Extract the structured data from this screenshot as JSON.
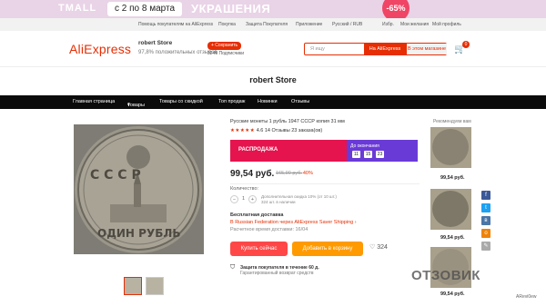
{
  "banner": {
    "brand": "TMALL",
    "dates": "с 2 по 8 марта",
    "promo": "УКРАШЕНИЯ",
    "discount": "-65%"
  },
  "topbar": {
    "items": [
      "Помощь покупателям на AliExpress",
      "Покупка",
      "Защита Покупателя",
      "Приложение",
      "Русский / RUB",
      "Избр.",
      "Мои желания",
      "Мой профиль"
    ]
  },
  "header": {
    "logo": "AliExpress",
    "store_name": "robert Store",
    "store_rating": "97,8% положительных отзывов",
    "save_button": "+ Сохранить",
    "subscribers": "3249 Подписчики",
    "search_placeholder": "Я ищу",
    "search_aliexpress": "На AliExpress",
    "search_store": "В этом магазине",
    "cart_count": "0"
  },
  "store_title": "robert Store",
  "nav": {
    "items": [
      "Главная страница",
      "Товары",
      "Товары со скидкой",
      "Топ продаж",
      "Новинки",
      "Отзывы"
    ]
  },
  "product": {
    "title": "Русские монеты 1 рубль 1947 СССР копия 31 мм",
    "stars": "★★★★★",
    "rating": "4.6",
    "reviews": "14 Отзывы",
    "orders": "23 заказа(ов)",
    "sale_label": "РАСПРОДАЖА",
    "countdown_label": "До окончания",
    "countdown": [
      "11",
      "15",
      "23"
    ],
    "price": "99,54 руб.",
    "old_price": "165,90 руб.",
    "discount": "-40%",
    "qty_label": "Количество:",
    "qty": "1",
    "qty_info_1": "Дополнительная скидка 10% (от 10 шт.)",
    "qty_info_2": "324 шт. в наличии",
    "shipping_title": "Бесплатная доставка",
    "shipping_line": "В Russian Federation через AliExpress Saver Shipping ›",
    "shipping_date": "Расчетное время доставки: 16/04",
    "buy_now": "Купить сейчас",
    "add_to_cart": "Добавить в корзину",
    "wish_count": "324",
    "protection_title": "Защита покупателя в течение 60 д.",
    "protection_sub": "Гарантированный возврат средств"
  },
  "recommend": {
    "title": "Рекомендуем вам",
    "prices": [
      "99,54 руб.",
      "99,54 руб.",
      "99,54 руб."
    ]
  },
  "coin": {
    "text_top": "С С С Р",
    "text_bottom": "ОДИН РУБЛЬ"
  },
  "watermark": {
    "brand": "ОТЗОВИК",
    "sub": "ARevi0ew"
  },
  "colors": {
    "accent": "#e62e04",
    "sale": "#e5144e",
    "countdown": "#6a3ad7",
    "buy": "#ff4747",
    "cart": "#ff9a00"
  }
}
